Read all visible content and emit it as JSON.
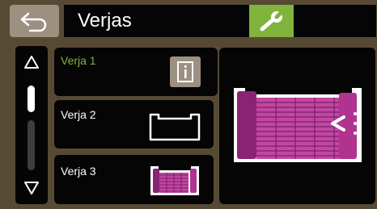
{
  "header": {
    "title": "Verjas",
    "back_icon": "back-arrow-icon",
    "settings_icon": "wrench-icon"
  },
  "scroll": {
    "up_icon": "triangle-up-icon",
    "down_icon": "triangle-down-icon"
  },
  "gates": [
    {
      "label": "Verja 1",
      "selected": true,
      "icon": "info-icon"
    },
    {
      "label": "Verja 2",
      "selected": false,
      "icon": "gate-outline-icon"
    },
    {
      "label": "Verja 3",
      "selected": false,
      "icon": "sliding-gate-icon"
    }
  ],
  "preview": {
    "icon": "sliding-gate-closing-icon"
  },
  "colors": {
    "background": "#574a35",
    "accent_green": "#80b43c",
    "button_grey": "#9c9080",
    "gate_magenta": "#b0338f",
    "panel_black": "#050505"
  }
}
